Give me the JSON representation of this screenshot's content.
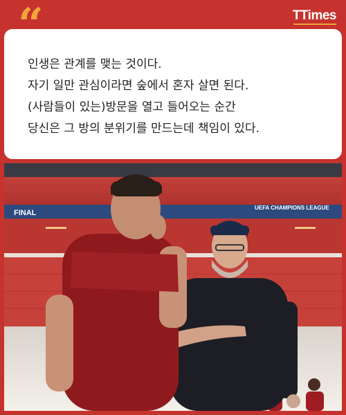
{
  "brand": {
    "logo_text": "TTimes"
  },
  "quote": {
    "mark": "“",
    "lines": [
      "인생은 관계를 맺는 것이다.",
      "자기 일만 관심이라면 숲에서 혼자 살면 된다.",
      "(사람들이 있는)방문을 열고 들어오는 순간",
      "당신은 그 방의 분위기를 만드는데 책임이 있다."
    ]
  },
  "photo": {
    "banner_left": "FINAL",
    "banner_right": "UEFA CHAMPIONS LEAGUE"
  },
  "colors": {
    "background": "#c6322d",
    "accent": "#f0a53a",
    "card": "#ffffff",
    "text": "#222222"
  }
}
